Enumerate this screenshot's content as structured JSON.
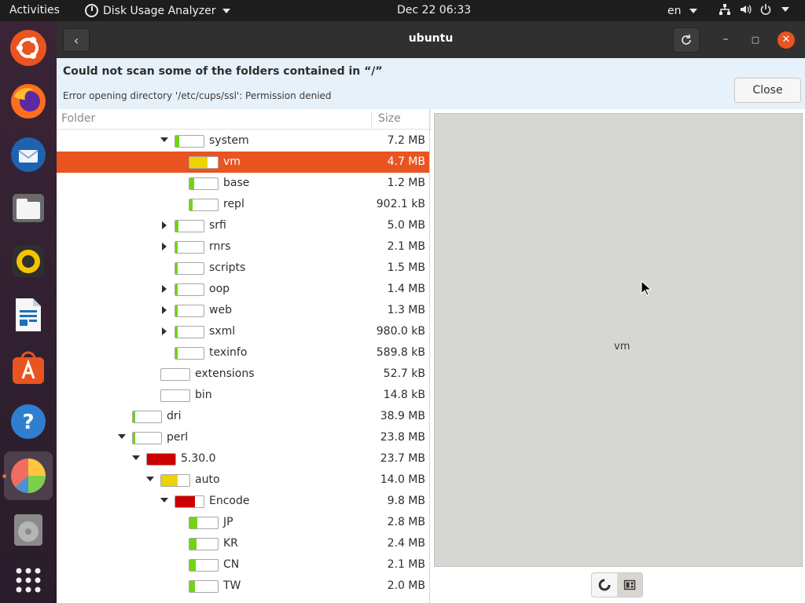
{
  "topbar": {
    "activities": "Activities",
    "app_name": "Disk Usage Analyzer",
    "clock": "Dec 22  06:33",
    "lang": "en",
    "icons": [
      "network-icon",
      "volume-icon",
      "power-icon"
    ]
  },
  "dock": {
    "items": [
      "ubuntu-logo-icon",
      "firefox-icon",
      "thunderbird-icon",
      "files-icon",
      "rhythmbox-icon",
      "writer-icon",
      "app-center-icon",
      "help-icon",
      "disk-usage-analyzer-icon",
      "disc-icon",
      "show-apps-icon"
    ]
  },
  "window": {
    "title": "ubuntu",
    "infobar": {
      "title": "Could not scan some of the folders contained in “/”",
      "detail": "Error opening directory '/etc/cups/ssl': Permission denied",
      "close_label": "Close"
    },
    "tree": {
      "col_folder": "Folder",
      "col_size": "Size",
      "rows": [
        {
          "name": "system",
          "size": "7.2 MB",
          "depth": 3,
          "expander": "down",
          "fill": 0.15,
          "color": "#73d216"
        },
        {
          "name": "vm",
          "size": "4.7 MB",
          "depth": 4,
          "expander": "none",
          "fill": 0.65,
          "color": "#edd400",
          "selected": true
        },
        {
          "name": "base",
          "size": "1.2 MB",
          "depth": 4,
          "expander": "none",
          "fill": 0.16,
          "color": "#73d216"
        },
        {
          "name": "repl",
          "size": "902.1 kB",
          "depth": 4,
          "expander": "none",
          "fill": 0.12,
          "color": "#73d216"
        },
        {
          "name": "srfi",
          "size": "5.0 MB",
          "depth": 3,
          "expander": "right",
          "fill": 0.1,
          "color": "#73d216"
        },
        {
          "name": "rnrs",
          "size": "2.1 MB",
          "depth": 3,
          "expander": "right",
          "fill": 0.04,
          "color": "#73d216"
        },
        {
          "name": "scripts",
          "size": "1.5 MB",
          "depth": 3,
          "expander": "none",
          "fill": 0.03,
          "color": "#73d216"
        },
        {
          "name": "oop",
          "size": "1.4 MB",
          "depth": 3,
          "expander": "right",
          "fill": 0.03,
          "color": "#73d216"
        },
        {
          "name": "web",
          "size": "1.3 MB",
          "depth": 3,
          "expander": "right",
          "fill": 0.02,
          "color": "#73d216"
        },
        {
          "name": "sxml",
          "size": "980.0 kB",
          "depth": 3,
          "expander": "right",
          "fill": 0.02,
          "color": "#73d216"
        },
        {
          "name": "texinfo",
          "size": "589.8 kB",
          "depth": 3,
          "expander": "none",
          "fill": 0.01,
          "color": "#73d216"
        },
        {
          "name": "extensions",
          "size": "52.7 kB",
          "depth": 2,
          "expander": "none",
          "fill": 0.0,
          "color": "#73d216"
        },
        {
          "name": "bin",
          "size": "14.8 kB",
          "depth": 2,
          "expander": "none",
          "fill": 0.0,
          "color": "#73d216"
        },
        {
          "name": "dri",
          "size": "38.9 MB",
          "depth": 0,
          "expander": "none",
          "fill": 0.04,
          "color": "#73d216"
        },
        {
          "name": "perl",
          "size": "23.8 MB",
          "depth": 0,
          "expander": "down",
          "fill": 0.02,
          "color": "#73d216"
        },
        {
          "name": "5.30.0",
          "size": "23.7 MB",
          "depth": 1,
          "expander": "down",
          "fill": 0.99,
          "color": "#cc0000"
        },
        {
          "name": "auto",
          "size": "14.0 MB",
          "depth": 2,
          "expander": "down",
          "fill": 0.59,
          "color": "#edd400"
        },
        {
          "name": "Encode",
          "size": "9.8 MB",
          "depth": 3,
          "expander": "down",
          "fill": 0.7,
          "color": "#cc0000"
        },
        {
          "name": "JP",
          "size": "2.8 MB",
          "depth": 4,
          "expander": "none",
          "fill": 0.28,
          "color": "#73d216"
        },
        {
          "name": "KR",
          "size": "2.4 MB",
          "depth": 4,
          "expander": "none",
          "fill": 0.24,
          "color": "#73d216"
        },
        {
          "name": "CN",
          "size": "2.1 MB",
          "depth": 4,
          "expander": "none",
          "fill": 0.21,
          "color": "#73d216"
        },
        {
          "name": "TW",
          "size": "2.0 MB",
          "depth": 4,
          "expander": "none",
          "fill": 0.2,
          "color": "#73d216"
        }
      ]
    },
    "chart": {
      "label": "vm"
    },
    "view_switch": {
      "options": [
        "rings-chart-icon",
        "treemap-chart-icon"
      ],
      "active": 1
    }
  },
  "colors": {
    "accent": "#e95420",
    "red": "#cc0000",
    "yellow": "#edd400",
    "green": "#73d216"
  }
}
